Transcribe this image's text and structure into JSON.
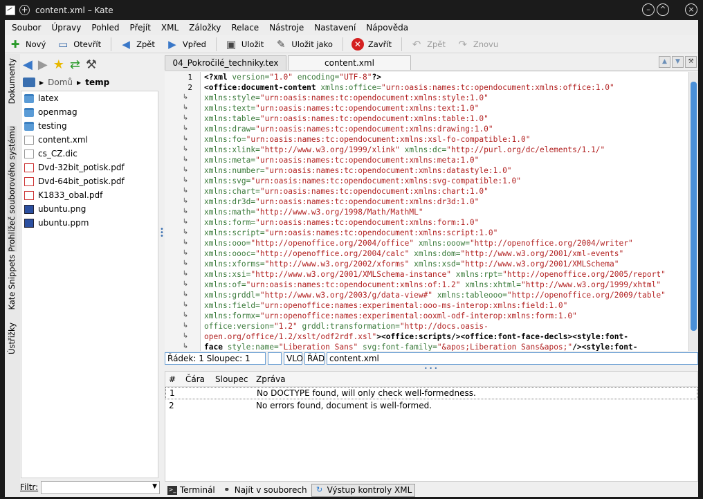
{
  "window": {
    "title": "content.xml – Kate"
  },
  "menu": [
    "Soubor",
    "Úpravy",
    "Pohled",
    "Přejít",
    "XML",
    "Záložky",
    "Relace",
    "Nástroje",
    "Nastavení",
    "Nápověda"
  ],
  "toolbar": {
    "new": "Nový",
    "open": "Otevřít",
    "back": "Zpět",
    "forward": "Vpřed",
    "save": "Uložit",
    "save_as": "Uložit jako",
    "close": "Zavřít",
    "undo": "Zpět",
    "redo": "Znovu"
  },
  "sidebar_tabs": [
    "Dokumenty",
    "Prohlížeč souborového systému",
    "Kate Snippets",
    "Ústřižky"
  ],
  "breadcrumb": {
    "home": "Domů",
    "current": "temp"
  },
  "files": [
    {
      "name": "latex",
      "type": "folder"
    },
    {
      "name": "openmag",
      "type": "folder"
    },
    {
      "name": "testing",
      "type": "folder"
    },
    {
      "name": "content.xml",
      "type": "doc"
    },
    {
      "name": "cs_CZ.dic",
      "type": "doc"
    },
    {
      "name": "Dvd-32bit_potisk.pdf",
      "type": "pdf"
    },
    {
      "name": "Dvd-64bit_potisk.pdf",
      "type": "pdf"
    },
    {
      "name": "K1833_obal.pdf",
      "type": "pdf"
    },
    {
      "name": "ubuntu.png",
      "type": "img"
    },
    {
      "name": "ubuntu.ppm",
      "type": "img"
    }
  ],
  "filter": {
    "label": "Filtr:",
    "value": ""
  },
  "editor_tabs": [
    "04_Pokročilé_techniky.tex",
    "content.xml"
  ],
  "line_numbers": [
    "1",
    "2"
  ],
  "code_lines": [
    [
      [
        "tag",
        "<?xml "
      ],
      [
        "attr",
        "version="
      ],
      [
        "val",
        "\"1.0\" "
      ],
      [
        "attr",
        "encoding="
      ],
      [
        "val",
        "\"UTF-8\""
      ],
      [
        "tag",
        "?>"
      ]
    ],
    [
      [
        "tag",
        "<office:document-content "
      ],
      [
        "attr",
        "xmlns:office="
      ],
      [
        "val",
        "\"urn:oasis:names:tc:opendocument:xmlns:office:1.0\""
      ]
    ],
    [
      [
        "attr",
        "xmlns:style="
      ],
      [
        "val",
        "\"urn:oasis:names:tc:opendocument:xmlns:style:1.0\""
      ]
    ],
    [
      [
        "attr",
        "xmlns:text="
      ],
      [
        "val",
        "\"urn:oasis:names:tc:opendocument:xmlns:text:1.0\""
      ]
    ],
    [
      [
        "attr",
        "xmlns:table="
      ],
      [
        "val",
        "\"urn:oasis:names:tc:opendocument:xmlns:table:1.0\""
      ]
    ],
    [
      [
        "attr",
        "xmlns:draw="
      ],
      [
        "val",
        "\"urn:oasis:names:tc:opendocument:xmlns:drawing:1.0\""
      ]
    ],
    [
      [
        "attr",
        "xmlns:fo="
      ],
      [
        "val",
        "\"urn:oasis:names:tc:opendocument:xmlns:xsl-fo-compatible:1.0\""
      ]
    ],
    [
      [
        "attr",
        "xmlns:xlink="
      ],
      [
        "val",
        "\"http://www.w3.org/1999/xlink\" "
      ],
      [
        "attr",
        "xmlns:dc="
      ],
      [
        "val",
        "\"http://purl.org/dc/elements/1.1/\""
      ]
    ],
    [
      [
        "attr",
        "xmlns:meta="
      ],
      [
        "val",
        "\"urn:oasis:names:tc:opendocument:xmlns:meta:1.0\""
      ]
    ],
    [
      [
        "attr",
        "xmlns:number="
      ],
      [
        "val",
        "\"urn:oasis:names:tc:opendocument:xmlns:datastyle:1.0\""
      ]
    ],
    [
      [
        "attr",
        "xmlns:svg="
      ],
      [
        "val",
        "\"urn:oasis:names:tc:opendocument:xmlns:svg-compatible:1.0\""
      ]
    ],
    [
      [
        "attr",
        "xmlns:chart="
      ],
      [
        "val",
        "\"urn:oasis:names:tc:opendocument:xmlns:chart:1.0\""
      ]
    ],
    [
      [
        "attr",
        "xmlns:dr3d="
      ],
      [
        "val",
        "\"urn:oasis:names:tc:opendocument:xmlns:dr3d:1.0\""
      ]
    ],
    [
      [
        "attr",
        "xmlns:math="
      ],
      [
        "val",
        "\"http://www.w3.org/1998/Math/MathML\""
      ]
    ],
    [
      [
        "attr",
        "xmlns:form="
      ],
      [
        "val",
        "\"urn:oasis:names:tc:opendocument:xmlns:form:1.0\""
      ]
    ],
    [
      [
        "attr",
        "xmlns:script="
      ],
      [
        "val",
        "\"urn:oasis:names:tc:opendocument:xmlns:script:1.0\""
      ]
    ],
    [
      [
        "attr",
        "xmlns:ooo="
      ],
      [
        "val",
        "\"http://openoffice.org/2004/office\" "
      ],
      [
        "attr",
        "xmlns:ooow="
      ],
      [
        "val",
        "\"http://openoffice.org/2004/writer\""
      ]
    ],
    [
      [
        "attr",
        "xmlns:oooc="
      ],
      [
        "val",
        "\"http://openoffice.org/2004/calc\" "
      ],
      [
        "attr",
        "xmlns:dom="
      ],
      [
        "val",
        "\"http://www.w3.org/2001/xml-events\""
      ]
    ],
    [
      [
        "attr",
        "xmlns:xforms="
      ],
      [
        "val",
        "\"http://www.w3.org/2002/xforms\" "
      ],
      [
        "attr",
        "xmlns:xsd="
      ],
      [
        "val",
        "\"http://www.w3.org/2001/XMLSchema\""
      ]
    ],
    [
      [
        "attr",
        "xmlns:xsi="
      ],
      [
        "val",
        "\"http://www.w3.org/2001/XMLSchema-instance\" "
      ],
      [
        "attr",
        "xmlns:rpt="
      ],
      [
        "val",
        "\"http://openoffice.org/2005/report\""
      ]
    ],
    [
      [
        "attr",
        "xmlns:of="
      ],
      [
        "val",
        "\"urn:oasis:names:tc:opendocument:xmlns:of:1.2\" "
      ],
      [
        "attr",
        "xmlns:xhtml="
      ],
      [
        "val",
        "\"http://www.w3.org/1999/xhtml\""
      ]
    ],
    [
      [
        "attr",
        "xmlns:grddl="
      ],
      [
        "val",
        "\"http://www.w3.org/2003/g/data-view#\" "
      ],
      [
        "attr",
        "xmlns:tableooo="
      ],
      [
        "val",
        "\"http://openoffice.org/2009/table\""
      ]
    ],
    [
      [
        "attr",
        "xmlns:field="
      ],
      [
        "val",
        "\"urn:openoffice:names:experimental:ooo-ms-interop:xmlns:field:1.0\""
      ]
    ],
    [
      [
        "attr",
        "xmlns:formx="
      ],
      [
        "val",
        "\"urn:openoffice:names:experimental:ooxml-odf-interop:xmlns:form:1.0\""
      ]
    ],
    [
      [
        "attr",
        "office:version="
      ],
      [
        "val",
        "\"1.2\" "
      ],
      [
        "attr",
        "grddl:transformation="
      ],
      [
        "val",
        "\"http://docs.oasis-"
      ]
    ],
    [
      [
        "val",
        "open.org/office/1.2/xslt/odf2rdf.xsl\""
      ],
      [
        "tag",
        ">"
      ],
      [
        "tag",
        "<office:scripts/>"
      ],
      [
        "tag",
        "<office:font-face-decls>"
      ],
      [
        "tag",
        "<style:font-"
      ]
    ],
    [
      [
        "tag",
        "face "
      ],
      [
        "attr",
        "style:name="
      ],
      [
        "val",
        "\"Liberation Sans\" "
      ],
      [
        "attr",
        "svg:font-family="
      ],
      [
        "val",
        "\"&apos;Liberation Sans&apos;\""
      ],
      [
        "tag",
        "/><style:font-"
      ]
    ]
  ],
  "status": {
    "position": "Řádek: 1 Sloupec: 1",
    "blank": "",
    "mode": "VLO",
    "insert": "ŘÁD",
    "file": "content.xml"
  },
  "xml_table": {
    "headers": [
      "#",
      "Čára",
      "Sloupec",
      "Zpráva"
    ],
    "rows": [
      {
        "n": "1",
        "line": "",
        "col": "",
        "msg": "No DOCTYPE found, will only check well-formedness."
      },
      {
        "n": "2",
        "line": "",
        "col": "",
        "msg": "No errors found, document is well-formed."
      }
    ]
  },
  "bottom_tabs": [
    "Terminál",
    "Najít v souborech",
    "Výstup kontroly XML"
  ]
}
